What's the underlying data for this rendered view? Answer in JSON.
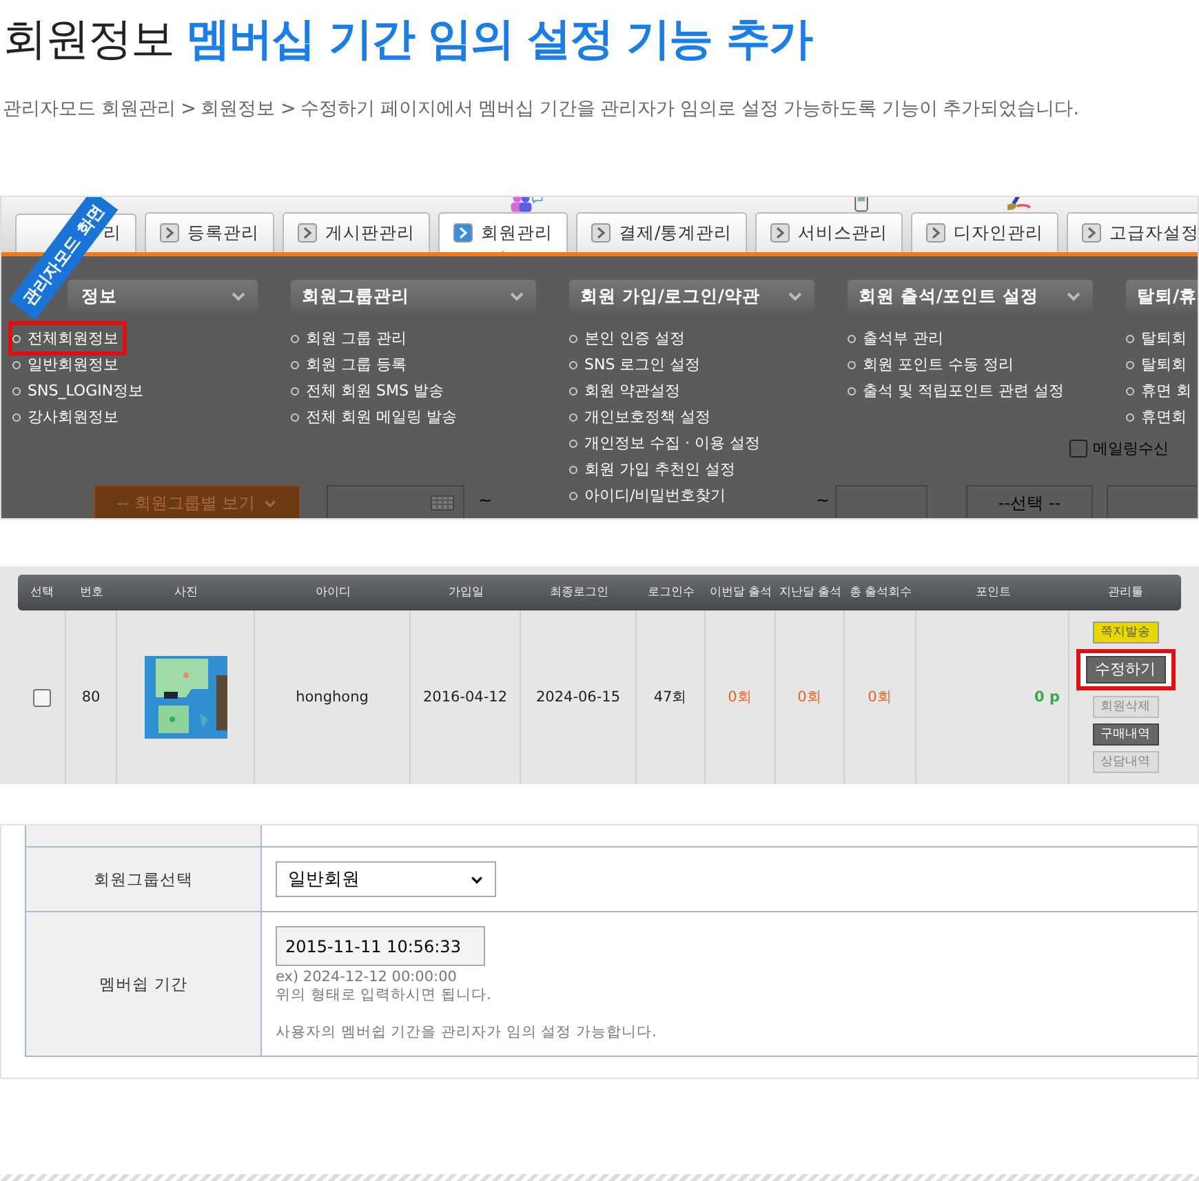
{
  "article": {
    "title_plain": "회원정보",
    "title_highlight": "멤버십 기간 임의 설정 기능 추가",
    "description": "관리자모드 회원관리 > 회원정보 > 수정하기 페이지에서 멤버십 기간을 관리자가 임의로 설정 가능하도록 기능이 추가되었습니다."
  },
  "admin_screen": {
    "ribbon": "관리자모드 화면",
    "tabs": [
      {
        "label": "리",
        "selected": false,
        "kind": "plain"
      },
      {
        "label": "등록관리",
        "selected": false,
        "kind": "plain"
      },
      {
        "label": "게시판관리",
        "selected": false,
        "kind": "plain"
      },
      {
        "label": "회원관리",
        "selected": true,
        "kind": "people"
      },
      {
        "label": "결제/통계관리",
        "selected": false,
        "kind": "plain"
      },
      {
        "label": "서비스관리",
        "selected": false,
        "kind": "phone"
      },
      {
        "label": "디자인관리",
        "selected": false,
        "kind": "brush"
      },
      {
        "label": "고급자설정",
        "selected": false,
        "kind": "plain"
      }
    ],
    "menu": [
      {
        "header": "정보",
        "chevron": true,
        "items": [
          {
            "label": "전체회원정보",
            "highlighted": true
          },
          {
            "label": "일반회원정보",
            "highlighted": false
          },
          {
            "label": "SNS_LOGIN정보",
            "highlighted": false
          },
          {
            "label": "강사회원정보",
            "highlighted": false
          }
        ]
      },
      {
        "header": "회원그룹관리",
        "chevron": true,
        "items": [
          {
            "label": "회원 그룹 관리",
            "highlighted": false
          },
          {
            "label": "회원 그룹 등록",
            "highlighted": false
          },
          {
            "label": "전체 회원 SMS 발송",
            "highlighted": false
          },
          {
            "label": "전체 회원 메일링 발송",
            "highlighted": false
          }
        ]
      },
      {
        "header": "회원 가입/로그인/약관",
        "chevron": true,
        "items": [
          {
            "label": "본인 인증 설정",
            "highlighted": false
          },
          {
            "label": "SNS 로그인 설정",
            "highlighted": false
          },
          {
            "label": "회원 약관설정",
            "highlighted": false
          },
          {
            "label": "개인보호정책 설정",
            "highlighted": false
          },
          {
            "label": "개인정보 수집 · 이용 설정",
            "highlighted": false
          },
          {
            "label": "회원 가입 추천인 설정",
            "highlighted": false
          },
          {
            "label": "아이디/비밀번호찾기",
            "highlighted": false
          }
        ]
      },
      {
        "header": "회원 출석/포인트 설정",
        "chevron": true,
        "items": [
          {
            "label": "출석부 관리",
            "highlighted": false
          },
          {
            "label": "회원 포인트 수동 정리",
            "highlighted": false
          },
          {
            "label": "출석 및 적립포인트 관련 설정",
            "highlighted": false
          }
        ]
      },
      {
        "header": "탈퇴/휴",
        "items": [
          {
            "label": "탈퇴회",
            "highlighted": false
          },
          {
            "label": "탈퇴회",
            "highlighted": false
          },
          {
            "label": "휴면 회",
            "highlighted": false
          },
          {
            "label": "휴면회",
            "highlighted": false
          }
        ]
      }
    ],
    "mailing_checkbox": {
      "label": "메일링수신",
      "checked": false
    },
    "group_select": "-- 회원그룹별 보기",
    "range_separators": [
      "~",
      "~"
    ],
    "status_select": "--선택 --"
  },
  "member_table": {
    "columns": [
      "선택",
      "번호",
      "사진",
      "아이디",
      "가입일",
      "최종로그인",
      "로그인수",
      "이번달 출석",
      "지난달 출석",
      "총 출석회수",
      "포인트",
      "관리툴"
    ],
    "rows": [
      {
        "checked": false,
        "number": "80",
        "user_id": "honghong",
        "joined": "2016-04-12",
        "last_login": "2024-06-15",
        "logins": "47회",
        "this_month": "0회",
        "last_month": "0회",
        "total_attendance": "0회",
        "points": "0 p",
        "actions": [
          {
            "label": "쪽지발송",
            "kind": "notice",
            "highlighted": false
          },
          {
            "label": "수정하기",
            "kind": "dark",
            "highlighted": true
          },
          {
            "label": "회원삭제",
            "kind": "light",
            "highlighted": false
          },
          {
            "label": "구매내역",
            "kind": "dark",
            "highlighted": false
          },
          {
            "label": "상담내역",
            "kind": "light",
            "highlighted": false
          }
        ]
      }
    ]
  },
  "member_form": {
    "rows": [
      {
        "label": "회원그룹선택",
        "kind": "select",
        "value": "일반회원"
      },
      {
        "label": "멤버쉽 기간",
        "kind": "date",
        "value": "2015-11-11 10:56:33",
        "hints": [
          "ex) 2024-12-12 00:00:00",
          "위의 형태로 입력하시면 됩니다."
        ],
        "note": "사용자의 멤버쉽 기간을 관리자가 임의 설정 가능합니다."
      }
    ]
  }
}
